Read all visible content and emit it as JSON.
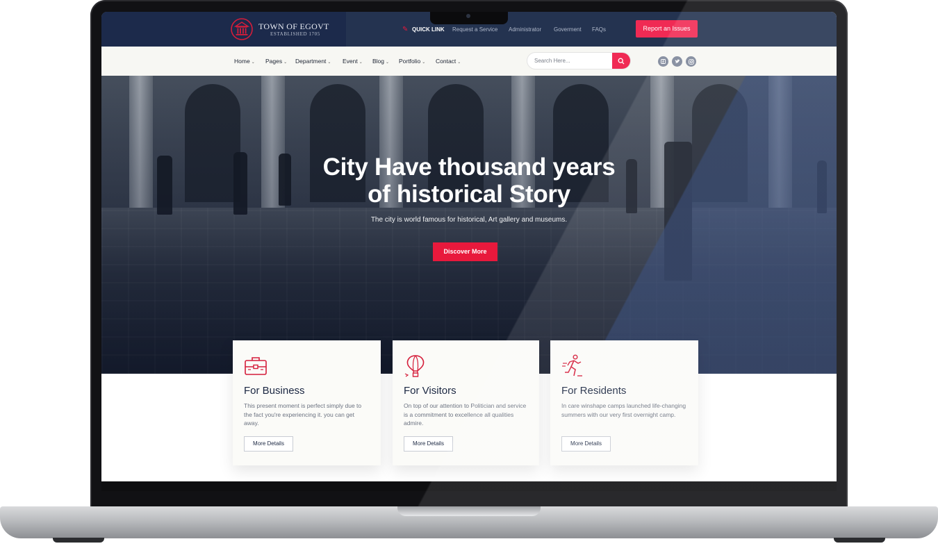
{
  "brand": {
    "name": "TOWN OF EGOVT",
    "established": "ESTABLISHED 1705",
    "accent": "#e8193c",
    "navy": "#1c2a4b"
  },
  "topbar": {
    "quick_link": "QUICK LINK",
    "links": [
      "Request a Service",
      "Administrator",
      "Goverment",
      "FAQs"
    ],
    "report_button": "Report an Issues"
  },
  "nav": {
    "items": [
      "Home",
      "Pages",
      "Department",
      "Event",
      "Blog",
      "Portfolio",
      "Contact"
    ],
    "search_placeholder": "Search Here...",
    "social_icons": [
      "facebook-icon",
      "twitter-icon",
      "instagram-icon"
    ]
  },
  "hero": {
    "title_line1": "City Have thousand years",
    "title_line2": "of historical Story",
    "subtitle": "The city is world famous for historical, Art gallery and museums.",
    "button": "Discover More"
  },
  "cards": [
    {
      "icon": "briefcase-icon",
      "title": "For Business",
      "text": "This present moment is perfect simply due to the fact you're experiencing it. you can get away.",
      "button": "More Details"
    },
    {
      "icon": "hot-air-balloon-icon",
      "title": "For Visitors",
      "text": "On top of our attention to Politician and service is a commitment to excellence all qualities admire.",
      "button": "More Details"
    },
    {
      "icon": "runner-icon",
      "title": "For Residents",
      "text": "In care winshape camps launched life-changing summers with our very first overnight camp.",
      "button": "More Details"
    }
  ]
}
